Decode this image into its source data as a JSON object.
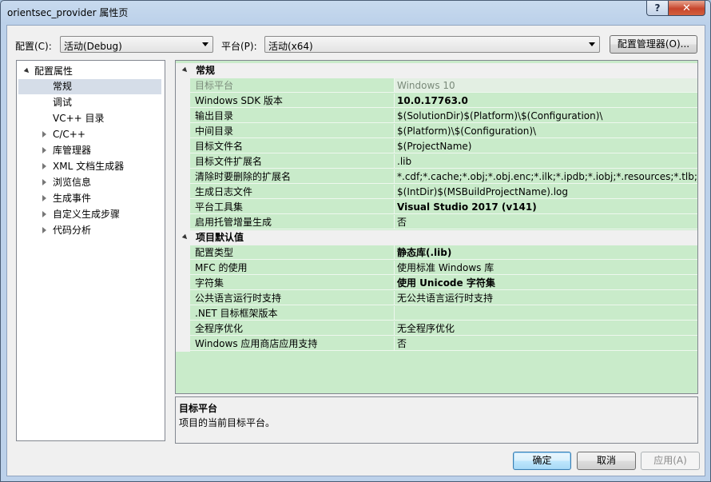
{
  "window": {
    "title": "orientsec_provider 属性页",
    "help_label": "?",
    "close_label": "✕"
  },
  "toolbar": {
    "config_label": "配置(C):",
    "config_value": "活动(Debug)",
    "platform_label": "平台(P):",
    "platform_value": "活动(x64)",
    "config_manager_label": "配置管理器(O)..."
  },
  "tree": {
    "root": "配置属性",
    "items": [
      "常规",
      "调试",
      "VC++ 目录",
      "C/C++",
      "库管理器",
      "XML 文档生成器",
      "浏览信息",
      "生成事件",
      "自定义生成步骤",
      "代码分析"
    ],
    "selected": "常规"
  },
  "grid": {
    "category1": "常规",
    "rows1": [
      {
        "name": "目标平台",
        "value": "Windows 10"
      },
      {
        "name": "Windows SDK 版本",
        "value": "10.0.17763.0"
      },
      {
        "name": "输出目录",
        "value": "$(SolutionDir)$(Platform)\\$(Configuration)\\"
      },
      {
        "name": "中间目录",
        "value": "$(Platform)\\$(Configuration)\\"
      },
      {
        "name": "目标文件名",
        "value": "$(ProjectName)"
      },
      {
        "name": "目标文件扩展名",
        "value": ".lib"
      },
      {
        "name": "清除时要删除的扩展名",
        "value": "*.cdf;*.cache;*.obj;*.obj.enc;*.ilk;*.ipdb;*.iobj;*.resources;*.tlb;*.tli;*.t"
      },
      {
        "name": "生成日志文件",
        "value": "$(IntDir)$(MSBuildProjectName).log"
      },
      {
        "name": "平台工具集",
        "value": "Visual Studio 2017 (v141)"
      },
      {
        "name": "启用托管增量生成",
        "value": "否"
      }
    ],
    "category2": "项目默认值",
    "rows2": [
      {
        "name": "配置类型",
        "value": "静态库(.lib)"
      },
      {
        "name": "MFC 的使用",
        "value": "使用标准 Windows 库"
      },
      {
        "name": "字符集",
        "value": "使用 Unicode 字符集"
      },
      {
        "name": "公共语言运行时支持",
        "value": "无公共语言运行时支持"
      },
      {
        "name": ".NET 目标框架版本",
        "value": ""
      },
      {
        "name": "全程序优化",
        "value": "无全程序优化"
      },
      {
        "name": "Windows 应用商店应用支持",
        "value": "否"
      }
    ]
  },
  "description": {
    "title": "目标平台",
    "text": "项目的当前目标平台。"
  },
  "buttons": {
    "ok": "确定",
    "cancel": "取消",
    "apply": "应用(A)"
  }
}
